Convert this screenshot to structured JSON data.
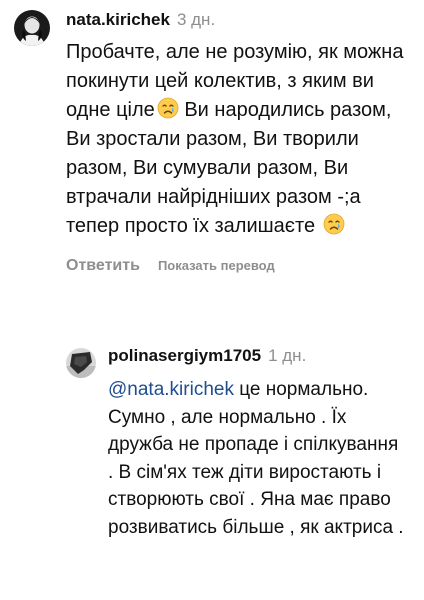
{
  "comments": [
    {
      "username": "nata.kirichek",
      "time": "3 дн.",
      "text_before_emoji": "Пробачте, але не розумію, як можна покинути цей колектив, з яким ви одне ціле",
      "text_after_emoji": " Ви народились разом, Ви зростали разом, Ви творили разом, Ви сумували разом, Ви втрачали найрідніших разом -;а тепер просто їх залишаєте ",
      "emoji_icon": "crying-face-icon",
      "reply_label": "Ответить",
      "translate_label": "Показать перевод"
    }
  ],
  "reply": {
    "username": "polinasergiym1705",
    "time": "1 дн.",
    "mention": "@nata.kirichek",
    "text": " це нормально. Сумно , але нормально . Їх дружба не пропаде і спілкування . В сім'ях теж діти виростають і створюють свої . Яна має право розвиватись більше , як актриса ."
  },
  "colors": {
    "mention": "#1f4d8f",
    "secondary_text": "#8e8e8e"
  }
}
